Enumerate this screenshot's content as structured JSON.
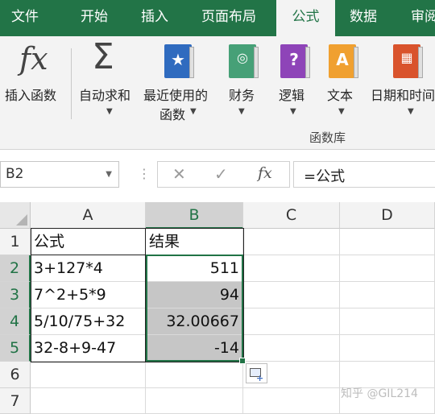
{
  "tabs": [
    "文件",
    "开始",
    "插入",
    "页面布局",
    "公式",
    "数据",
    "审阅"
  ],
  "ribbon": {
    "insert_function": {
      "label": "插入函数",
      "icon": "fx-icon"
    },
    "autosum": {
      "label": "自动求和",
      "icon": "sigma-icon"
    },
    "recent": {
      "line1": "最近使用的",
      "line2": "函数",
      "icon": "star-book-icon"
    },
    "financial": {
      "label": "财务",
      "icon": "coins-book-icon"
    },
    "logical": {
      "label": "逻辑",
      "icon": "question-book-icon"
    },
    "text": {
      "label": "文本",
      "icon": "letter-a-book-icon"
    },
    "datetime": {
      "label": "日期和时间",
      "icon": "calendar-book-icon"
    },
    "group_label": "函数库",
    "fx_symbol": "fx",
    "sigma_symbol": "Σ"
  },
  "formula_bar": {
    "name_box": "B2",
    "cancel": "✕",
    "enter": "✓",
    "fx": "fx",
    "content": "=公式"
  },
  "sheet": {
    "columns": [
      "A",
      "B",
      "C",
      "D"
    ],
    "rows": [
      "1",
      "2",
      "3",
      "4",
      "5",
      "6",
      "7"
    ],
    "cells": {
      "A1": "公式",
      "B1": "结果",
      "A2": "3+127*4",
      "B2": "511",
      "A3": "7^2+5*9",
      "B3": "94",
      "A4": "5/10/75+32",
      "B4": "32.00667",
      "A5": "32-8+9-47",
      "B5": "-14"
    }
  },
  "watermark": "知乎 @GIL214",
  "colors": {
    "accent": "#227447",
    "selection_fill": "#c6c6c6"
  }
}
